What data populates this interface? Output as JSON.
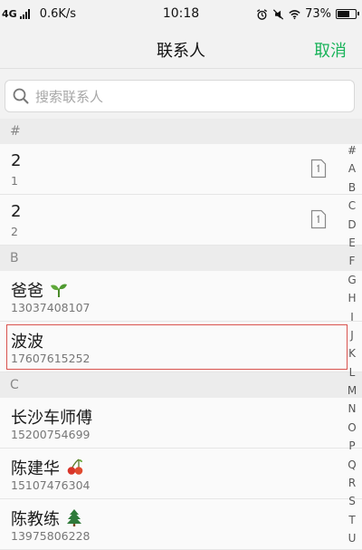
{
  "status_bar": {
    "network": "4G",
    "speed": "0.6K/s",
    "time": "10:18",
    "battery": "73%",
    "battery_level": 0.73,
    "icons": [
      "signal-icon",
      "alarm-icon",
      "mute-icon",
      "wifi-icon",
      "battery-icon"
    ]
  },
  "header": {
    "title": "联系人",
    "cancel_label": "取消"
  },
  "search": {
    "placeholder": "搜索联系人",
    "value": ""
  },
  "sections": [
    {
      "header": "#",
      "contacts": [
        {
          "name": "2",
          "number": "1",
          "icon": "sim-card-icon"
        },
        {
          "name": "2",
          "number": "2",
          "icon": "sim-card-icon"
        }
      ]
    },
    {
      "header": "B",
      "contacts": [
        {
          "name": "爸爸",
          "number": "13037408107",
          "emoji": "sprout-icon"
        },
        {
          "name": "波波",
          "number": "17607615252",
          "selected": true
        }
      ]
    },
    {
      "header": "C",
      "contacts": [
        {
          "name": "长沙车师傅",
          "number": "15200754699"
        },
        {
          "name": "陈建华",
          "number": "15107476304",
          "emoji": "cherries-icon"
        },
        {
          "name": "陈教练",
          "number": "13975806228",
          "emoji": "evergreen-tree-icon"
        }
      ]
    }
  ],
  "index_letters": [
    "#",
    "A",
    "B",
    "C",
    "D",
    "E",
    "F",
    "G",
    "H",
    "I",
    "J",
    "K",
    "L",
    "M",
    "N",
    "O",
    "P",
    "Q",
    "R",
    "S",
    "T",
    "U"
  ],
  "colors": {
    "accent": "#19b35a",
    "selection_border": "#d9534f",
    "background": "#f2f2f2"
  }
}
